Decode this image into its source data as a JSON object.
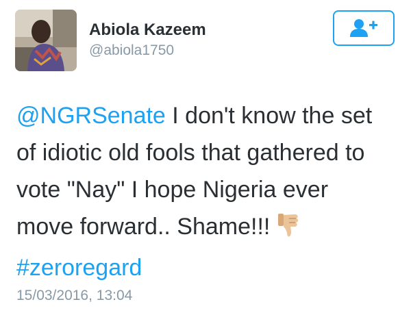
{
  "user": {
    "display_name": "Abiola Kazeem",
    "handle": "@abiola1750",
    "avatar_icon": "profile-photo"
  },
  "follow_button": {
    "icon": "add-user-icon",
    "color": "#1da1f2"
  },
  "tweet": {
    "mention": "@NGRSenate",
    "line1_rest": " I don't know the set",
    "line2": "of idiotic old fools that gathered to",
    "line3": "vote \"Nay\" I hope Nigeria ever",
    "line4": "move forward.. Shame!!!",
    "emoji": "thumbs-down",
    "hashtag": "#zeroregard"
  },
  "timestamp": "15/03/2016, 13:04",
  "colors": {
    "link": "#1da1f2",
    "text": "#292f33",
    "muted": "#8899a6"
  }
}
